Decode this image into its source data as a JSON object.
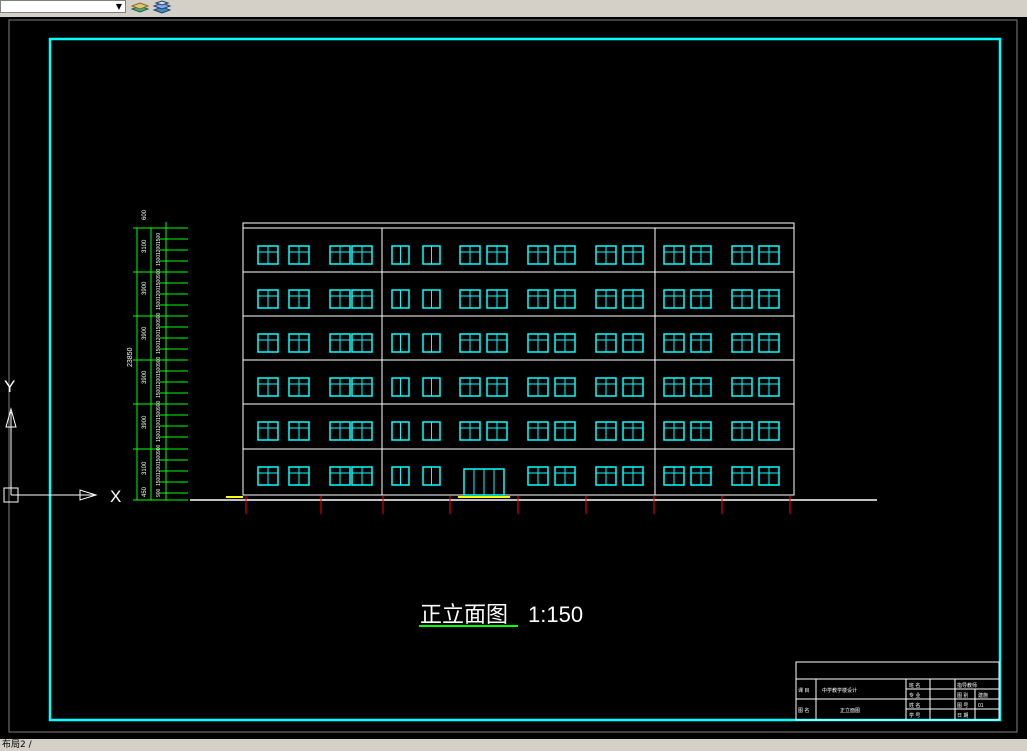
{
  "toolbar": {
    "layer_value": "",
    "icons": [
      "layer-states-icon",
      "layer-manager-icon"
    ]
  },
  "drawing": {
    "title_cn": "正立面图",
    "scale": "1:150",
    "axis_x": "X",
    "axis_y": "Y",
    "dimensions": {
      "total_height": "23850",
      "segments": [
        "450",
        "3100",
        "3900",
        "3900",
        "3900",
        "3900",
        "3100",
        "600"
      ],
      "sub_dims": [
        "900",
        "1500",
        "1200",
        "1500"
      ]
    }
  },
  "title_block": {
    "project_label": "课 目",
    "project_value": "中学教学楼设计",
    "drawing_label": "图 名",
    "drawing_value": "正立面图",
    "fields": [
      "班 名",
      "专 业",
      "姓 名",
      "学 号"
    ],
    "right_fields": [
      "指导教师",
      "图 别",
      "图 号",
      "日 期"
    ],
    "right_values": [
      "建施",
      "01"
    ]
  },
  "status": {
    "text": "布局2 /"
  },
  "colors": {
    "frame": "#00ffff",
    "window": "#00ffff",
    "dimension": "#00ff00",
    "outline": "#ffffff",
    "grid_mark": "#ff0000"
  }
}
